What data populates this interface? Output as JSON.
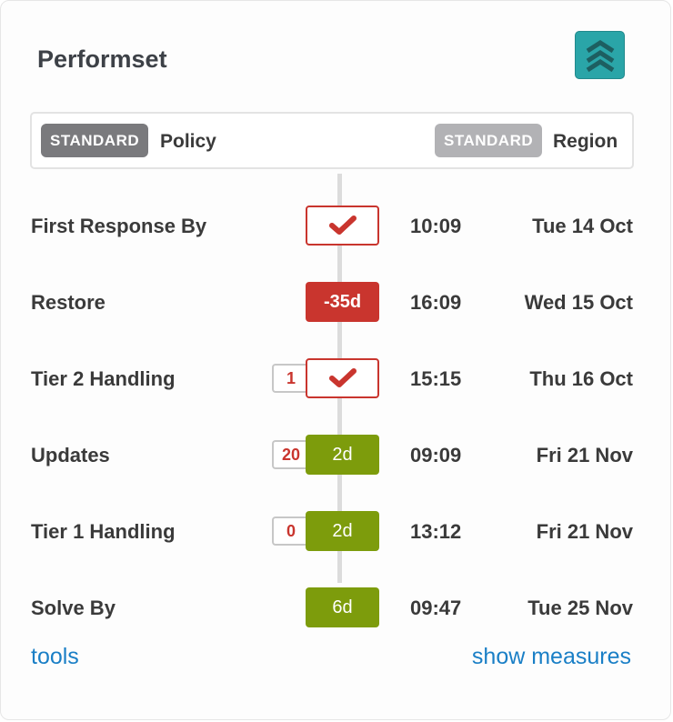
{
  "header": {
    "title": "Performset",
    "collapse_icon": "double-chevron-up-icon",
    "accent": "#2aa5a8"
  },
  "policy_box": {
    "policy_badge": "STANDARD",
    "policy_label": "Policy",
    "region_badge": "STANDARD",
    "region_label": "Region"
  },
  "rows": [
    {
      "name": "First Response By",
      "count": "",
      "status": "",
      "status_kind": "check",
      "time": "10:09",
      "date": "Tue 14 Oct"
    },
    {
      "name": "Restore",
      "count": "",
      "status": "-35d",
      "status_kind": "red",
      "time": "16:09",
      "date": "Wed 15 Oct"
    },
    {
      "name": "Tier 2 Handling",
      "count": "1",
      "status": "",
      "status_kind": "check",
      "time": "15:15",
      "date": "Thu 16 Oct"
    },
    {
      "name": "Updates",
      "count": "20",
      "status": "2d",
      "status_kind": "green",
      "time": "09:09",
      "date": "Fri 21 Nov"
    },
    {
      "name": "Tier 1 Handling",
      "count": "0",
      "status": "2d",
      "status_kind": "green",
      "time": "13:12",
      "date": "Fri 21 Nov"
    },
    {
      "name": "Solve By",
      "count": "",
      "status": "6d",
      "status_kind": "green",
      "time": "09:47",
      "date": "Tue 25 Nov"
    }
  ],
  "footer": {
    "tools_label": "tools",
    "measures_label": "show measures"
  },
  "colors": {
    "red": "#c9352e",
    "green": "#7d9c0c",
    "link": "#1a7fc6"
  }
}
